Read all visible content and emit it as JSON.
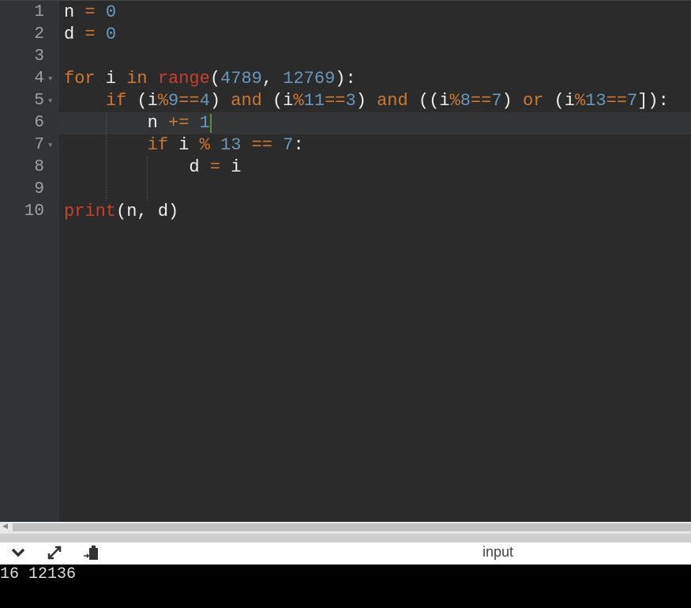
{
  "editor": {
    "active_line": 6,
    "lines": [
      [
        [
          "t",
          "n "
        ],
        [
          "o",
          "="
        ],
        [
          "t",
          " "
        ],
        [
          "n",
          "0"
        ]
      ],
      [
        [
          "t",
          "d "
        ],
        [
          "o",
          "="
        ],
        [
          "t",
          " "
        ],
        [
          "n",
          "0"
        ]
      ],
      [],
      [
        [
          "k",
          "for"
        ],
        [
          "t",
          " i "
        ],
        [
          "k",
          "in"
        ],
        [
          "t",
          " "
        ],
        [
          "b",
          "range"
        ],
        [
          "t",
          "("
        ],
        [
          "n",
          "4789"
        ],
        [
          "t",
          ", "
        ],
        [
          "n",
          "12769"
        ],
        [
          "t",
          "):"
        ]
      ],
      [
        [
          "t",
          "    "
        ],
        [
          "k",
          "if"
        ],
        [
          "t",
          " (i"
        ],
        [
          "o",
          "%"
        ],
        [
          "n",
          "9"
        ],
        [
          "o",
          "=="
        ],
        [
          "n",
          "4"
        ],
        [
          "t",
          ") "
        ],
        [
          "k",
          "and"
        ],
        [
          "t",
          " (i"
        ],
        [
          "o",
          "%"
        ],
        [
          "n",
          "11"
        ],
        [
          "o",
          "=="
        ],
        [
          "n",
          "3"
        ],
        [
          "t",
          ") "
        ],
        [
          "k",
          "and"
        ],
        [
          "t",
          " ((i"
        ],
        [
          "o",
          "%"
        ],
        [
          "n",
          "8"
        ],
        [
          "o",
          "=="
        ],
        [
          "n",
          "7"
        ],
        [
          "t",
          ") "
        ],
        [
          "k",
          "or"
        ],
        [
          "t",
          " (i"
        ],
        [
          "o",
          "%"
        ],
        [
          "n",
          "13"
        ],
        [
          "o",
          "=="
        ],
        [
          "n",
          "7"
        ],
        [
          "t",
          "]):"
        ]
      ],
      [
        [
          "t",
          "        n "
        ],
        [
          "o",
          "+="
        ],
        [
          "t",
          " "
        ],
        [
          "n",
          "1"
        ]
      ],
      [
        [
          "t",
          "        "
        ],
        [
          "k",
          "if"
        ],
        [
          "t",
          " i "
        ],
        [
          "o",
          "%"
        ],
        [
          "t",
          " "
        ],
        [
          "n",
          "13"
        ],
        [
          "t",
          " "
        ],
        [
          "o",
          "=="
        ],
        [
          "t",
          " "
        ],
        [
          "n",
          "7"
        ],
        [
          "t",
          ":"
        ]
      ],
      [
        [
          "t",
          "            d "
        ],
        [
          "o",
          "="
        ],
        [
          "t",
          " i"
        ]
      ],
      [],
      [
        [
          "b",
          "print"
        ],
        [
          "t",
          "(n, d)"
        ]
      ]
    ],
    "foldable_lines": [
      4,
      5,
      7
    ]
  },
  "toolbar": {
    "icons": [
      "chevron-down-icon",
      "expand-icon",
      "paste-icon"
    ],
    "input_label": "input"
  },
  "output": {
    "text": "16 12136"
  }
}
